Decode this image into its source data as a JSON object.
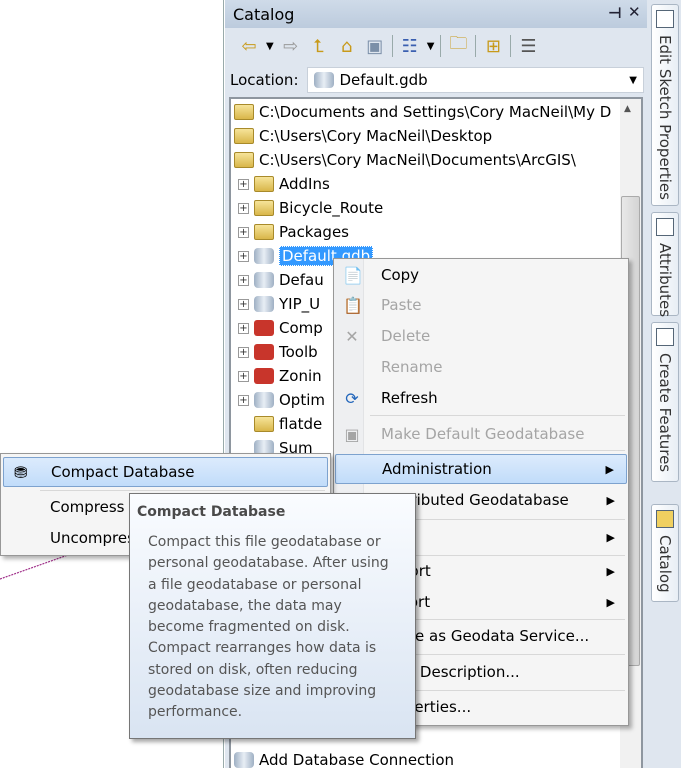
{
  "catalog": {
    "title": "Catalog",
    "pin_icon": "pin-icon",
    "close_icon": "close-icon",
    "toolbar": [
      "back-icon",
      "dropdown-icon",
      "forward-icon",
      "up-icon",
      "home-icon",
      "default-gdb-icon",
      "views-icon",
      "dropdown-icon",
      "connect-folder-icon",
      "tree-icon",
      "options-icon"
    ],
    "location_label": "Location:",
    "location_value": "Default.gdb",
    "tree": [
      {
        "label": "C:\\Documents and Settings\\Cory MacNeil\\My D",
        "icon": "folder",
        "expand": false
      },
      {
        "label": "C:\\Users\\Cory MacNeil\\Desktop",
        "icon": "folder",
        "expand": false
      },
      {
        "label": "C:\\Users\\Cory MacNeil\\Documents\\ArcGIS\\",
        "icon": "folder",
        "expand": false
      },
      {
        "label": "AddIns",
        "icon": "folder",
        "expand": true
      },
      {
        "label": "Bicycle_Route",
        "icon": "folder",
        "expand": true
      },
      {
        "label": "Packages",
        "icon": "folder",
        "expand": true
      },
      {
        "label": "Default.gdb",
        "icon": "gdb",
        "expand": true,
        "selected": true
      },
      {
        "label": "Defau",
        "icon": "gdb",
        "expand": true
      },
      {
        "label": "YIP_U",
        "icon": "gdb",
        "expand": true
      },
      {
        "label": "Comp",
        "icon": "toolbox",
        "expand": true
      },
      {
        "label": "Toolb",
        "icon": "toolbox",
        "expand": true
      },
      {
        "label": "Zonin",
        "icon": "toolbox",
        "expand": true
      },
      {
        "label": "Optim",
        "icon": "tool",
        "expand": true
      },
      {
        "label": "flatde",
        "icon": "layer",
        "expand": false
      },
      {
        "label": "Sum",
        "icon": "table",
        "expand": false
      }
    ],
    "add_db_connection": "Add Database Connection"
  },
  "context_menu": [
    {
      "label": "Copy",
      "icon": "copy-icon",
      "enabled": true
    },
    {
      "label": "Paste",
      "icon": "paste-icon",
      "enabled": false
    },
    {
      "label": "Delete",
      "icon": "delete-icon",
      "enabled": false
    },
    {
      "label": "Rename",
      "enabled": false
    },
    {
      "label": "Refresh",
      "icon": "refresh-icon",
      "enabled": true
    },
    {
      "label": "Make Default Geodatabase",
      "icon": "default-gdb-icon",
      "enabled": false
    },
    {
      "label": "Administration",
      "enabled": true,
      "submenu": true,
      "highlighted": true
    },
    {
      "label": "Distributed Geodatabase",
      "enabled": true,
      "submenu": true
    },
    {
      "label": "",
      "enabled": true,
      "submenu": true
    },
    {
      "label": "Import",
      "enabled": true,
      "submenu": true
    },
    {
      "label": "Export",
      "enabled": true,
      "submenu": true
    },
    {
      "label": "Share as Geodata Service...",
      "enabled": true
    },
    {
      "label": "Item Description...",
      "enabled": true
    },
    {
      "label": "Properties...",
      "enabled": true
    }
  ],
  "submenu": [
    {
      "label": "Compact Database",
      "icon": "compact-icon",
      "highlighted": true
    },
    {
      "label": "Compress"
    },
    {
      "label": "Uncompress"
    }
  ],
  "tooltip": {
    "title": "Compact Database",
    "lines": [
      "Compact this file geodatabase or",
      "personal geodatabase. After using",
      "a file geodatabase or personal",
      "geodatabase, the data may",
      "become fragmented on disk.",
      "Compact rearranges how data is",
      "stored on disk, often reducing",
      "geodatabase size and improving",
      "performance."
    ]
  },
  "side_tabs": [
    "Edit Sketch Properties",
    "Attributes",
    "Create Features",
    "Catalog"
  ],
  "colors": {
    "selection": "#3399ff",
    "menu_highlight": "#c1dcfa",
    "map_line": "#a0308a"
  }
}
